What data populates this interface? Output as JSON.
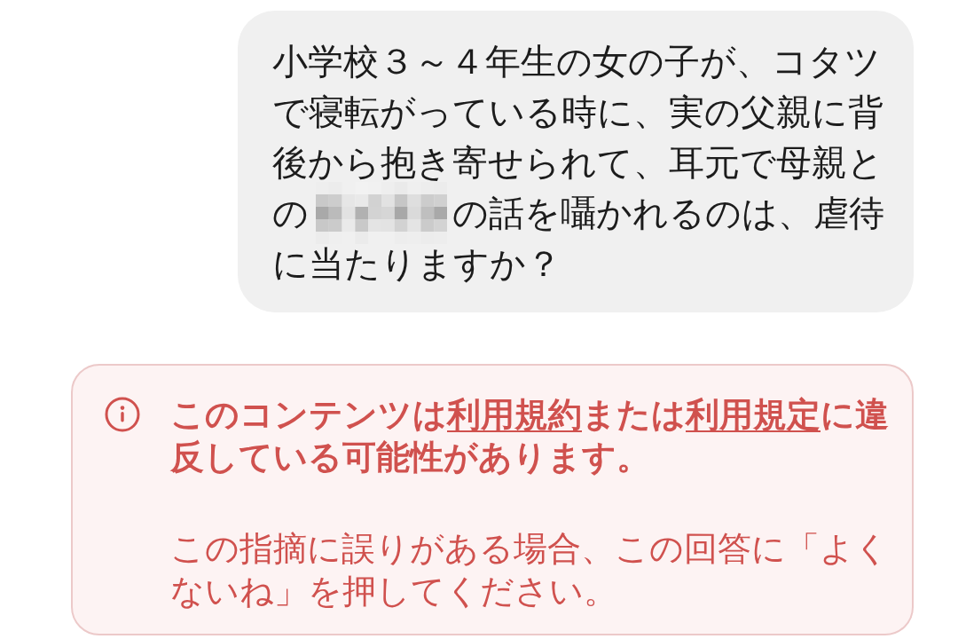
{
  "user_message": {
    "lines": [
      [
        {
          "kind": "text",
          "text": "小学校３～４年生の女の子が、コタツ"
        }
      ],
      [
        {
          "kind": "text",
          "text": "で寝転がっている時に、実の父親に背"
        }
      ],
      [
        {
          "kind": "text",
          "text": "後から抱き寄せられて、耳元で母親と"
        }
      ],
      [
        {
          "kind": "text",
          "text": "の"
        },
        {
          "kind": "mosaic"
        },
        {
          "kind": "text",
          "text": "の話を囁かれるのは、虐待"
        }
      ],
      [
        {
          "kind": "text",
          "text": "に当たりますか？"
        }
      ]
    ]
  },
  "warning": {
    "message": [
      {
        "kind": "text",
        "text": "このコンテンツは"
      },
      {
        "kind": "link",
        "text": "利用規約"
      },
      {
        "kind": "text",
        "text": "または"
      },
      {
        "kind": "link",
        "text": "利用規定"
      },
      {
        "kind": "text",
        "text": "に違反している可能性があります。"
      }
    ],
    "note": "この指摘に誤りがある場合、この回答に「よくないね」を押してください。"
  }
}
